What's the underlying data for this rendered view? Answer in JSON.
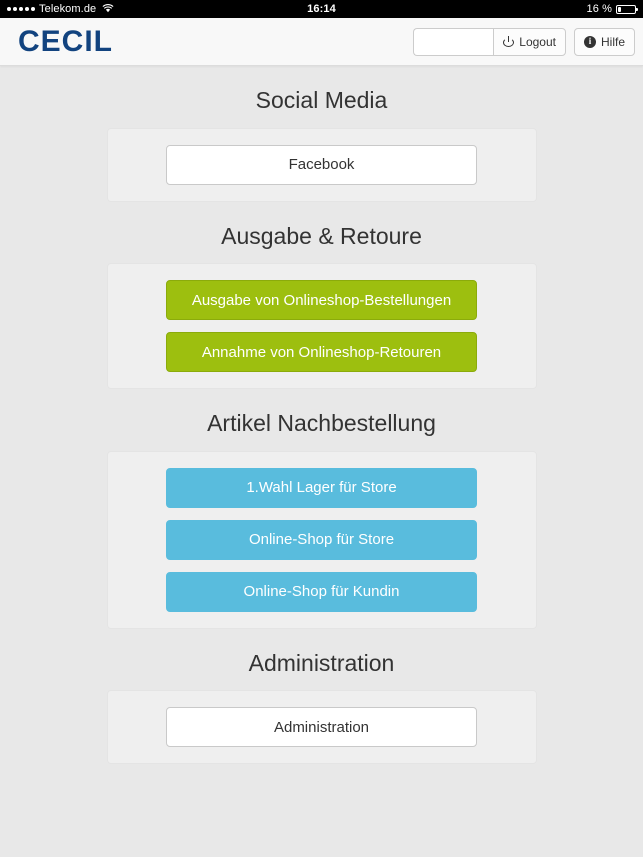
{
  "status_bar": {
    "signal_dots": 5,
    "carrier": "Telekom.de",
    "wifi_icon": "wifi-icon",
    "time": "16:14",
    "battery_percent": "16 %",
    "battery_level": 16
  },
  "header": {
    "brand": "CECIL",
    "search_value": "",
    "search_placeholder": "",
    "logout_label": "Logout",
    "logout_icon": "power-icon",
    "help_label": "Hilfe",
    "help_icon": "info-circle-icon"
  },
  "sections": [
    {
      "title": "Social Media",
      "buttons": [
        {
          "label": "Facebook",
          "style": "white"
        }
      ]
    },
    {
      "title": "Ausgabe & Retoure",
      "buttons": [
        {
          "label": "Ausgabe von Onlineshop-Bestellungen",
          "style": "green"
        },
        {
          "label": "Annahme von Onlineshop-Retouren",
          "style": "green"
        }
      ]
    },
    {
      "title": "Artikel Nachbestellung",
      "buttons": [
        {
          "label": "1.Wahl Lager für Store",
          "style": "blue"
        },
        {
          "label": "Online-Shop für Store",
          "style": "blue"
        },
        {
          "label": "Online-Shop für Kundin",
          "style": "blue"
        }
      ]
    },
    {
      "title": "Administration",
      "buttons": [
        {
          "label": "Administration",
          "style": "white"
        }
      ]
    }
  ],
  "colors": {
    "brand": "#12437f",
    "green": "#9dbf0f",
    "blue": "#59bcdd",
    "page_background": "#e8e8e8",
    "panel_background": "#efefef",
    "header_background": "#f8f8f8"
  }
}
